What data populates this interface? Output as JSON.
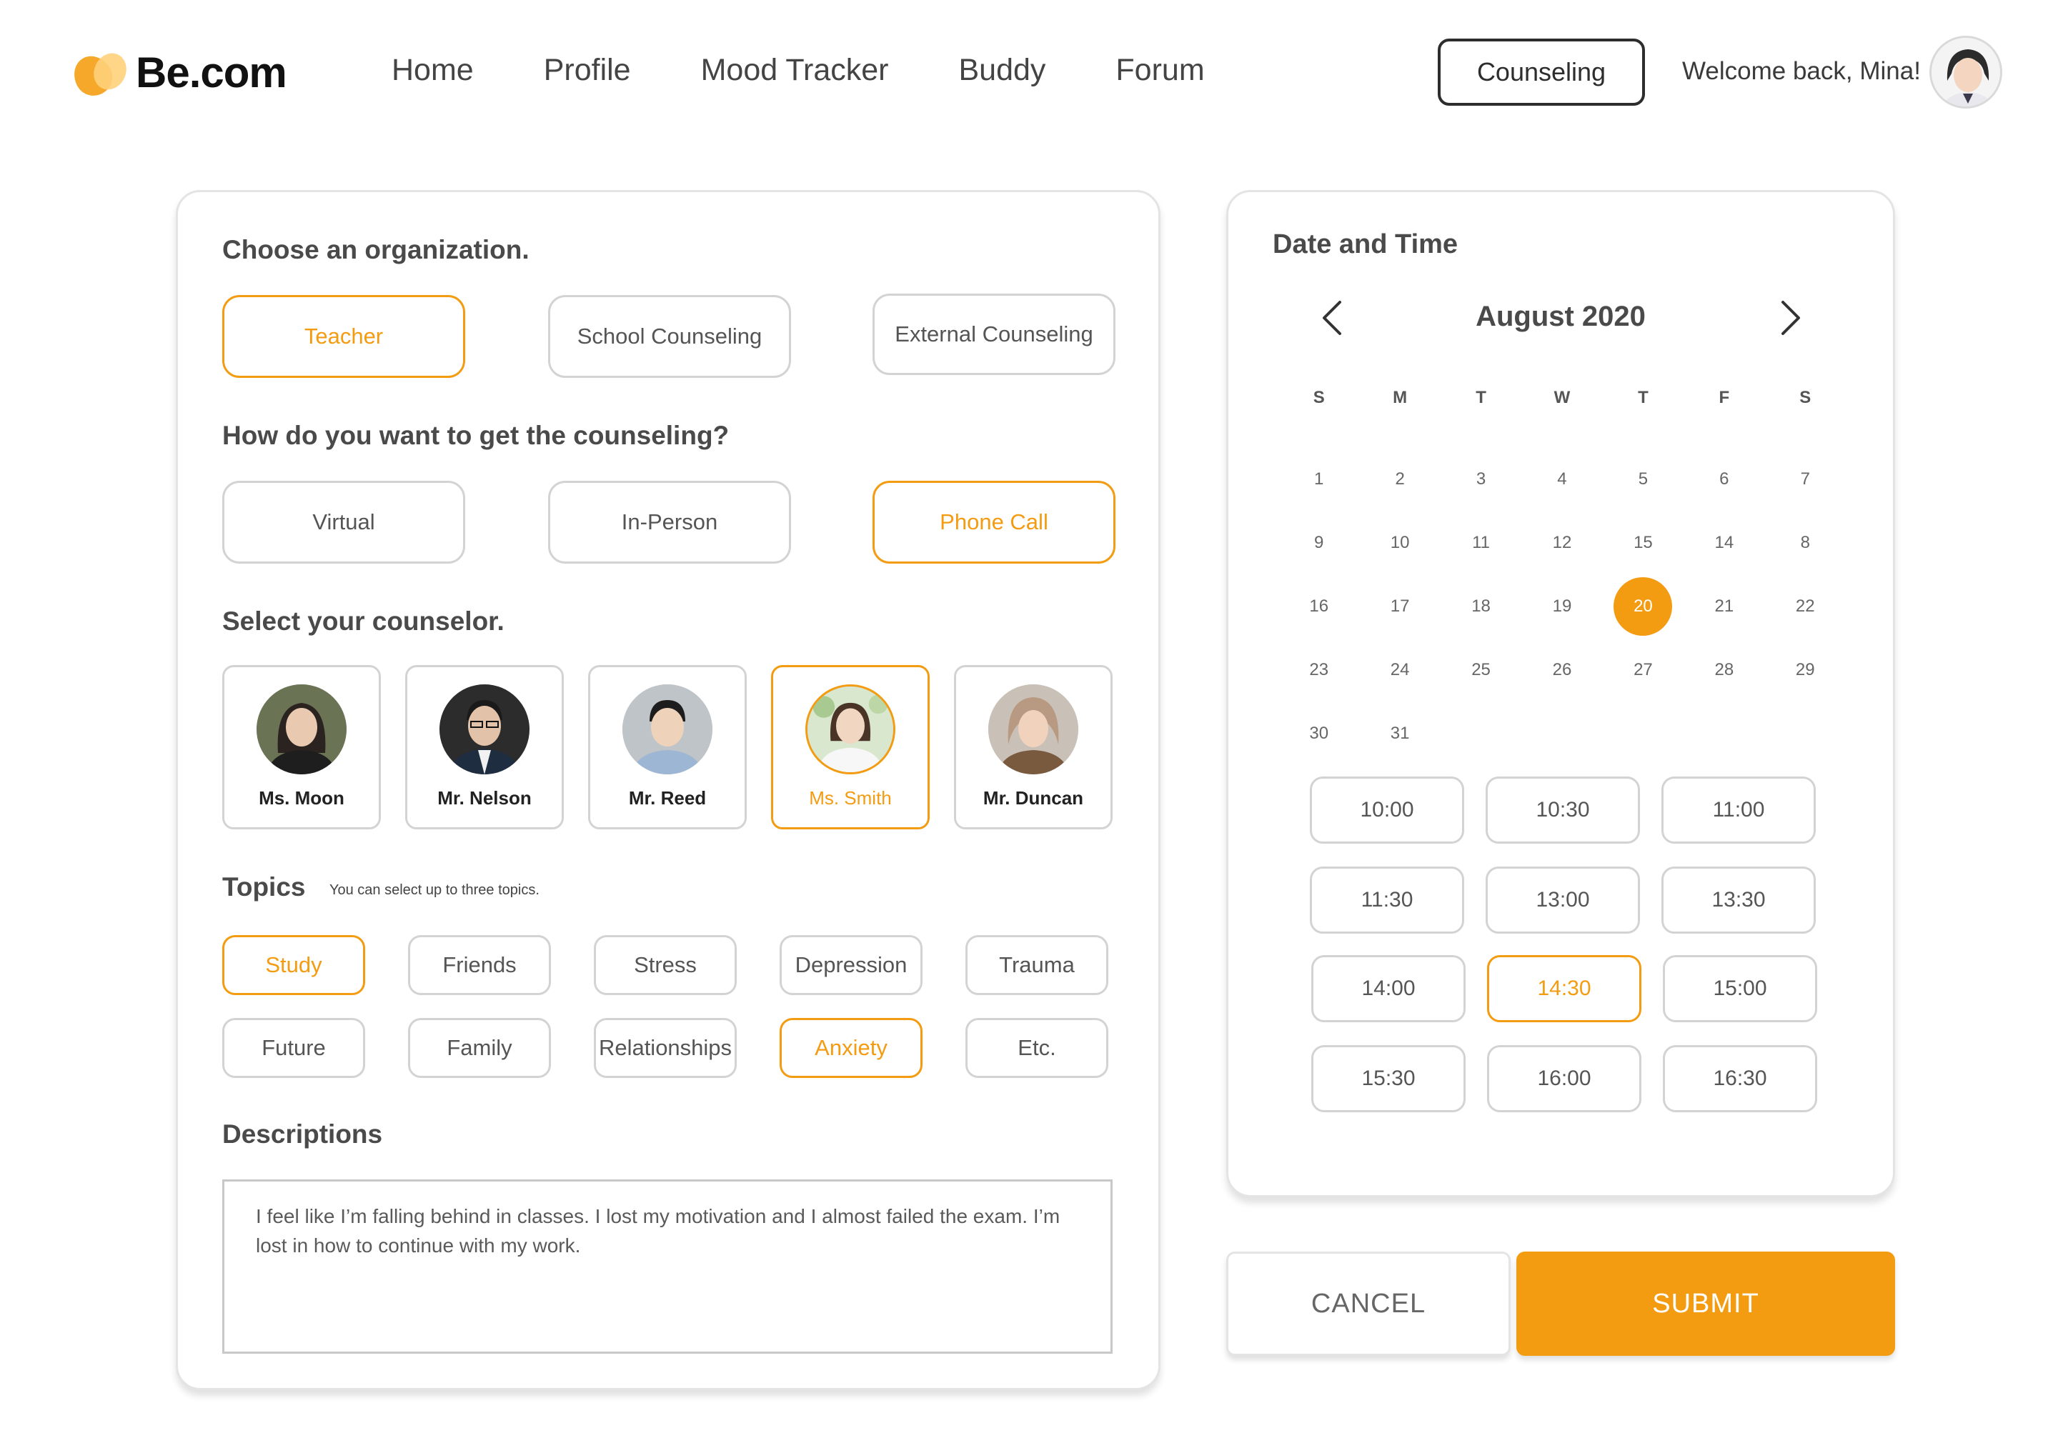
{
  "brand": {
    "name": "Be.com",
    "accent": "#f39c12"
  },
  "nav": {
    "items": [
      "Home",
      "Profile",
      "Mood Tracker",
      "Buddy",
      "Forum"
    ]
  },
  "header": {
    "counseling_label": "Counseling",
    "welcome": "Welcome back, Mina!"
  },
  "form": {
    "org_title": "Choose an organization.",
    "orgs": [
      {
        "label": "Teacher",
        "selected": true
      },
      {
        "label": "School Counseling",
        "selected": false
      },
      {
        "label": "External Counseling",
        "selected": false
      }
    ],
    "method_title": "How do you want to get the counseling?",
    "methods": [
      {
        "label": "Virtual",
        "selected": false
      },
      {
        "label": "In-Person",
        "selected": false
      },
      {
        "label": "Phone Call",
        "selected": true
      }
    ],
    "counselor_title": "Select your counselor.",
    "counselors": [
      {
        "name": "Ms. Moon",
        "selected": false
      },
      {
        "name": "Mr. Nelson",
        "selected": false
      },
      {
        "name": "Mr. Reed",
        "selected": false
      },
      {
        "name": "Ms. Smith",
        "selected": true
      },
      {
        "name": "Mr. Duncan",
        "selected": false
      }
    ],
    "topics_title": "Topics",
    "topics_note": "You can select up to three topics.",
    "topics": [
      {
        "label": "Study",
        "selected": true
      },
      {
        "label": "Friends",
        "selected": false
      },
      {
        "label": "Stress",
        "selected": false
      },
      {
        "label": "Depression",
        "selected": false
      },
      {
        "label": "Trauma",
        "selected": false
      },
      {
        "label": "Future",
        "selected": false
      },
      {
        "label": "Family",
        "selected": false
      },
      {
        "label": "Relationships",
        "selected": false
      },
      {
        "label": "Anxiety",
        "selected": true
      },
      {
        "label": "Etc.",
        "selected": false
      }
    ],
    "desc_title": "Descriptions",
    "description": "I feel like I’m falling behind in classes. I lost my motivation and I almost failed the exam. I’m lost in how to continue with my work."
  },
  "calendar": {
    "title": "Date and Time",
    "month_label": "August 2020",
    "weekdays": [
      "S",
      "M",
      "T",
      "W",
      "T",
      "F",
      "S"
    ],
    "days": [
      "1",
      "2",
      "3",
      "4",
      "5",
      "6",
      "7",
      "9",
      "10",
      "11",
      "12",
      "15",
      "14",
      "8",
      "16",
      "17",
      "18",
      "19",
      "20",
      "21",
      "22",
      "23",
      "24",
      "25",
      "26",
      "27",
      "28",
      "29",
      "30",
      "31"
    ],
    "selected_day": "20",
    "times": [
      "10:00",
      "10:30",
      "11:00",
      "11:30",
      "13:00",
      "13:30",
      "14:00",
      "14:30",
      "15:00",
      "15:30",
      "16:00",
      "16:30"
    ],
    "selected_time": "14:30"
  },
  "actions": {
    "cancel": "CANCEL",
    "submit": "SUBMIT"
  }
}
